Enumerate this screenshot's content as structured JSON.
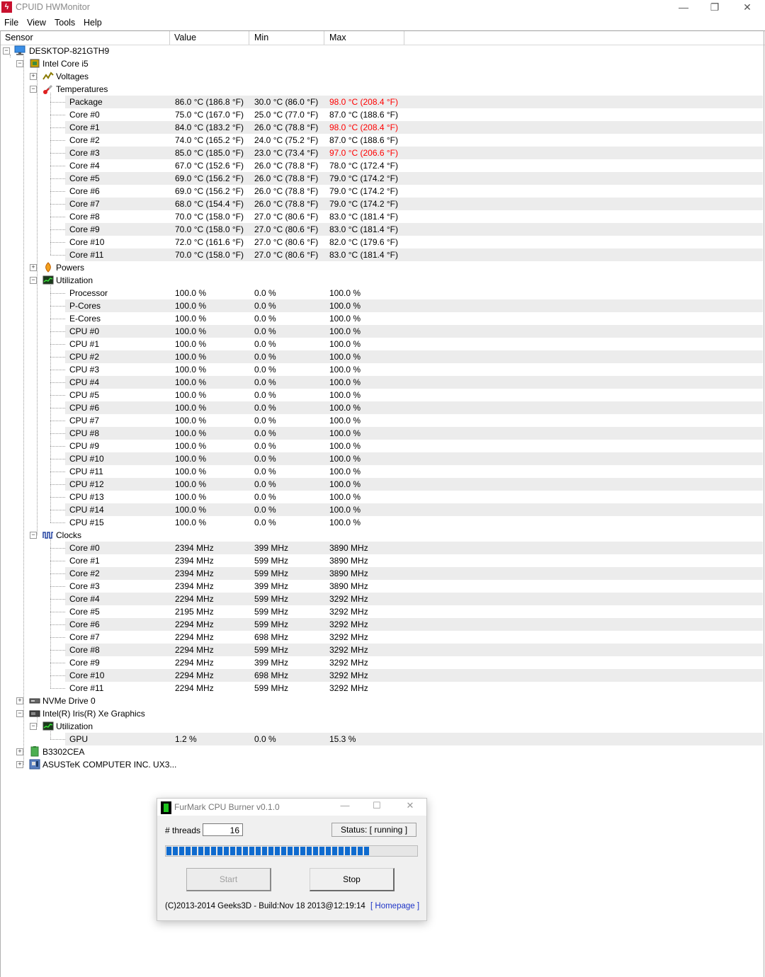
{
  "window": {
    "title": "CPUID HWMonitor",
    "app_icon": "hwmonitor-icon",
    "minimize": "—",
    "maximize": "❐",
    "close": "✕"
  },
  "menu": [
    "File",
    "View",
    "Tools",
    "Help"
  ],
  "columns": [
    "Sensor",
    "Value",
    "Min",
    "Max"
  ],
  "colors": {
    "alarm": "#ff0000",
    "row_stripe": "#ececec",
    "progress": "#0f6bcf",
    "link": "#1f35c7"
  },
  "tree": {
    "computer": "DESKTOP-821GTH9",
    "cpu": "Intel Core i5",
    "voltages": "Voltages",
    "temperatures": "Temperatures",
    "temp_rows": [
      {
        "name": "Package",
        "value": "86.0 °C  (186.8 °F)",
        "min": "30.0 °C  (86.0 °F)",
        "max": "98.0 °C  (208.4 °F)",
        "hot": true
      },
      {
        "name": "Core #0",
        "value": "75.0 °C  (167.0 °F)",
        "min": "25.0 °C  (77.0 °F)",
        "max": "87.0 °C  (188.6 °F)",
        "hot": false
      },
      {
        "name": "Core #1",
        "value": "84.0 °C  (183.2 °F)",
        "min": "26.0 °C  (78.8 °F)",
        "max": "98.0 °C  (208.4 °F)",
        "hot": true
      },
      {
        "name": "Core #2",
        "value": "74.0 °C  (165.2 °F)",
        "min": "24.0 °C  (75.2 °F)",
        "max": "87.0 °C  (188.6 °F)",
        "hot": false
      },
      {
        "name": "Core #3",
        "value": "85.0 °C  (185.0 °F)",
        "min": "23.0 °C  (73.4 °F)",
        "max": "97.0 °C  (206.6 °F)",
        "hot": true
      },
      {
        "name": "Core #4",
        "value": "67.0 °C  (152.6 °F)",
        "min": "26.0 °C  (78.8 °F)",
        "max": "78.0 °C  (172.4 °F)",
        "hot": false
      },
      {
        "name": "Core #5",
        "value": "69.0 °C  (156.2 °F)",
        "min": "26.0 °C  (78.8 °F)",
        "max": "79.0 °C  (174.2 °F)",
        "hot": false
      },
      {
        "name": "Core #6",
        "value": "69.0 °C  (156.2 °F)",
        "min": "26.0 °C  (78.8 °F)",
        "max": "79.0 °C  (174.2 °F)",
        "hot": false
      },
      {
        "name": "Core #7",
        "value": "68.0 °C  (154.4 °F)",
        "min": "26.0 °C  (78.8 °F)",
        "max": "79.0 °C  (174.2 °F)",
        "hot": false
      },
      {
        "name": "Core #8",
        "value": "70.0 °C  (158.0 °F)",
        "min": "27.0 °C  (80.6 °F)",
        "max": "83.0 °C  (181.4 °F)",
        "hot": false
      },
      {
        "name": "Core #9",
        "value": "70.0 °C  (158.0 °F)",
        "min": "27.0 °C  (80.6 °F)",
        "max": "83.0 °C  (181.4 °F)",
        "hot": false
      },
      {
        "name": "Core #10",
        "value": "72.0 °C  (161.6 °F)",
        "min": "27.0 °C  (80.6 °F)",
        "max": "82.0 °C  (179.6 °F)",
        "hot": false
      },
      {
        "name": "Core #11",
        "value": "70.0 °C  (158.0 °F)",
        "min": "27.0 °C  (80.6 °F)",
        "max": "83.0 °C  (181.4 °F)",
        "hot": false
      }
    ],
    "powers": "Powers",
    "utilization": "Utilization",
    "util_rows": [
      {
        "name": "Processor",
        "value": "100.0 %",
        "min": "0.0 %",
        "max": "100.0 %"
      },
      {
        "name": "P-Cores",
        "value": "100.0 %",
        "min": "0.0 %",
        "max": "100.0 %"
      },
      {
        "name": "E-Cores",
        "value": "100.0 %",
        "min": "0.0 %",
        "max": "100.0 %"
      },
      {
        "name": "CPU #0",
        "value": "100.0 %",
        "min": "0.0 %",
        "max": "100.0 %"
      },
      {
        "name": "CPU #1",
        "value": "100.0 %",
        "min": "0.0 %",
        "max": "100.0 %"
      },
      {
        "name": "CPU #2",
        "value": "100.0 %",
        "min": "0.0 %",
        "max": "100.0 %"
      },
      {
        "name": "CPU #3",
        "value": "100.0 %",
        "min": "0.0 %",
        "max": "100.0 %"
      },
      {
        "name": "CPU #4",
        "value": "100.0 %",
        "min": "0.0 %",
        "max": "100.0 %"
      },
      {
        "name": "CPU #5",
        "value": "100.0 %",
        "min": "0.0 %",
        "max": "100.0 %"
      },
      {
        "name": "CPU #6",
        "value": "100.0 %",
        "min": "0.0 %",
        "max": "100.0 %"
      },
      {
        "name": "CPU #7",
        "value": "100.0 %",
        "min": "0.0 %",
        "max": "100.0 %"
      },
      {
        "name": "CPU #8",
        "value": "100.0 %",
        "min": "0.0 %",
        "max": "100.0 %"
      },
      {
        "name": "CPU #9",
        "value": "100.0 %",
        "min": "0.0 %",
        "max": "100.0 %"
      },
      {
        "name": "CPU #10",
        "value": "100.0 %",
        "min": "0.0 %",
        "max": "100.0 %"
      },
      {
        "name": "CPU #11",
        "value": "100.0 %",
        "min": "0.0 %",
        "max": "100.0 %"
      },
      {
        "name": "CPU #12",
        "value": "100.0 %",
        "min": "0.0 %",
        "max": "100.0 %"
      },
      {
        "name": "CPU #13",
        "value": "100.0 %",
        "min": "0.0 %",
        "max": "100.0 %"
      },
      {
        "name": "CPU #14",
        "value": "100.0 %",
        "min": "0.0 %",
        "max": "100.0 %"
      },
      {
        "name": "CPU #15",
        "value": "100.0 %",
        "min": "0.0 %",
        "max": "100.0 %"
      }
    ],
    "clocks": "Clocks",
    "clock_rows": [
      {
        "name": "Core #0",
        "value": "2394 MHz",
        "min": "399 MHz",
        "max": "3890 MHz"
      },
      {
        "name": "Core #1",
        "value": "2394 MHz",
        "min": "599 MHz",
        "max": "3890 MHz"
      },
      {
        "name": "Core #2",
        "value": "2394 MHz",
        "min": "599 MHz",
        "max": "3890 MHz"
      },
      {
        "name": "Core #3",
        "value": "2394 MHz",
        "min": "399 MHz",
        "max": "3890 MHz"
      },
      {
        "name": "Core #4",
        "value": "2294 MHz",
        "min": "599 MHz",
        "max": "3292 MHz"
      },
      {
        "name": "Core #5",
        "value": "2195 MHz",
        "min": "599 MHz",
        "max": "3292 MHz"
      },
      {
        "name": "Core #6",
        "value": "2294 MHz",
        "min": "599 MHz",
        "max": "3292 MHz"
      },
      {
        "name": "Core #7",
        "value": "2294 MHz",
        "min": "698 MHz",
        "max": "3292 MHz"
      },
      {
        "name": "Core #8",
        "value": "2294 MHz",
        "min": "599 MHz",
        "max": "3292 MHz"
      },
      {
        "name": "Core #9",
        "value": "2294 MHz",
        "min": "399 MHz",
        "max": "3292 MHz"
      },
      {
        "name": "Core #10",
        "value": "2294 MHz",
        "min": "698 MHz",
        "max": "3292 MHz"
      },
      {
        "name": "Core #11",
        "value": "2294 MHz",
        "min": "599 MHz",
        "max": "3292 MHz"
      }
    ],
    "nvme": "NVMe Drive 0",
    "gpu": "Intel(R) Iris(R) Xe Graphics",
    "gpu_util": "Utilization",
    "gpu_row": {
      "name": "GPU",
      "value": "1.2 %",
      "min": "0.0 %",
      "max": "15.3 %"
    },
    "battery": "B3302CEA",
    "board": "ASUSTeK COMPUTER INC. UX3..."
  },
  "dialog": {
    "title": "FurMark CPU Burner v0.1.0",
    "minimize": "—",
    "maximize": "☐",
    "close": "✕",
    "threads_label": "# threads",
    "threads_value": "16",
    "status": "Status: [ running ]",
    "progress_fraction": 0.81,
    "start_label": "Start",
    "stop_label": "Stop",
    "footer": "(C)2013-2014 Geeks3D - Build:Nov 18 2013@12:19:14",
    "homepage": "[ Homepage ]"
  }
}
